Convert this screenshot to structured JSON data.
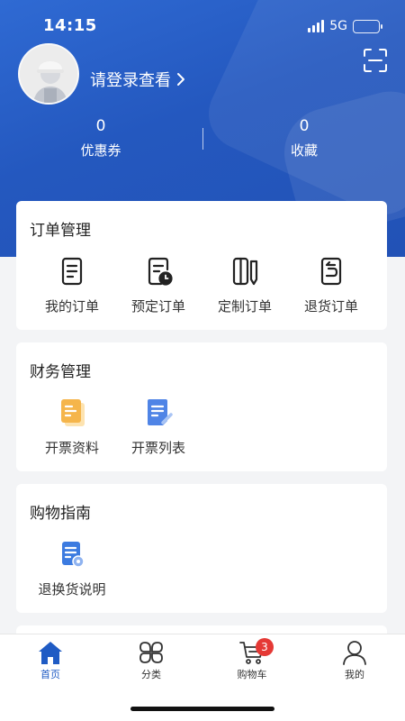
{
  "status_bar": {
    "time": "14:15",
    "network": "5G"
  },
  "profile": {
    "login_prompt": "请登录查看"
  },
  "stats": [
    {
      "value": "0",
      "label": "优惠券"
    },
    {
      "value": "0",
      "label": "收藏"
    }
  ],
  "orders": {
    "title": "订单管理",
    "items": [
      {
        "label": "我的订单",
        "icon": "order-list-icon"
      },
      {
        "label": "预定订单",
        "icon": "order-clock-icon"
      },
      {
        "label": "定制订单",
        "icon": "order-pencil-icon"
      },
      {
        "label": "退货订单",
        "icon": "order-return-icon"
      }
    ]
  },
  "finance": {
    "title": "财务管理",
    "items": [
      {
        "label": "开票资料",
        "icon": "invoice-info-icon",
        "color": "#f5b54b"
      },
      {
        "label": "开票列表",
        "icon": "invoice-list-icon",
        "color": "#4f84e6"
      }
    ]
  },
  "guide": {
    "title": "购物指南",
    "items": [
      {
        "label": "退换货说明",
        "icon": "return-guide-icon",
        "color": "#3c7be0"
      }
    ]
  },
  "tabbar": {
    "items": [
      {
        "label": "首页",
        "icon": "home-icon",
        "active": true
      },
      {
        "label": "分类",
        "icon": "category-icon"
      },
      {
        "label": "购物车",
        "icon": "cart-icon",
        "badge": "3"
      },
      {
        "label": "我的",
        "icon": "user-icon"
      }
    ]
  },
  "colors": {
    "brand_blue": "#2458bf",
    "active_tab": "#1f5bc4",
    "badge_red": "#e53935"
  }
}
